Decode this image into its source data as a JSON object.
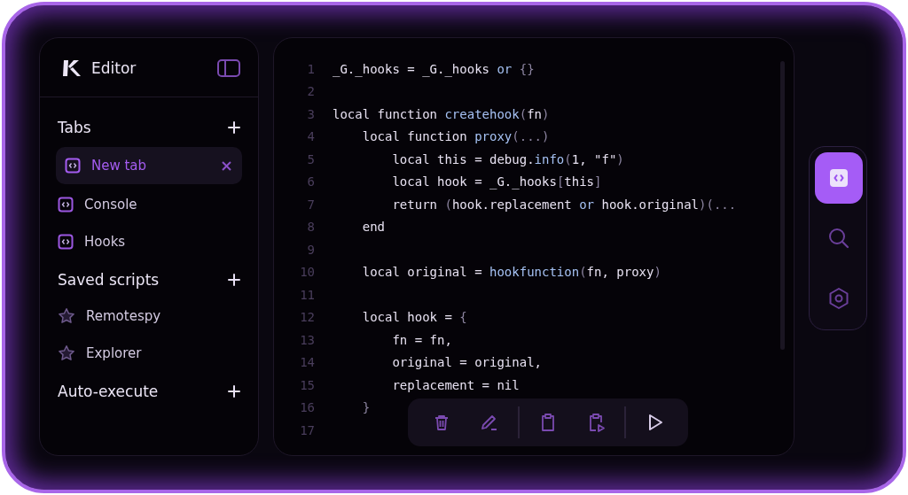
{
  "sidebar": {
    "title": "Editor",
    "sections": [
      {
        "title": "Tabs",
        "items": [
          {
            "label": "New tab",
            "kind": "tab",
            "selected": true
          },
          {
            "label": "Console",
            "kind": "tab",
            "selected": false
          },
          {
            "label": "Hooks",
            "kind": "tab",
            "selected": false
          }
        ]
      },
      {
        "title": "Saved scripts",
        "items": [
          {
            "label": "Remotespy",
            "kind": "script",
            "selected": false
          },
          {
            "label": "Explorer",
            "kind": "script",
            "selected": false
          }
        ]
      },
      {
        "title": "Auto-execute"
      }
    ]
  },
  "editor": {
    "lines": [
      {
        "number": "1",
        "tokens": [
          {
            "text": "_G._hooks = _G._hooks ",
            "kind": "plain"
          },
          {
            "text": "or",
            "kind": "accent"
          },
          {
            "text": " {}",
            "kind": "punct"
          }
        ]
      },
      {
        "number": "2"
      },
      {
        "number": "3",
        "tokens": [
          {
            "text": "local function ",
            "kind": "plain"
          },
          {
            "text": "createhook",
            "kind": "accent"
          },
          {
            "text": "(",
            "kind": "punct"
          },
          {
            "text": "fn",
            "kind": "plain"
          },
          {
            "text": ")",
            "kind": "punct"
          }
        ]
      },
      {
        "number": "4",
        "tokens": [
          {
            "text": "    local function ",
            "kind": "plain"
          },
          {
            "text": "proxy",
            "kind": "accent"
          },
          {
            "text": "(...)",
            "kind": "punct"
          }
        ]
      },
      {
        "number": "5",
        "tokens": [
          {
            "text": "        local this = debug.",
            "kind": "plain"
          },
          {
            "text": "info",
            "kind": "accent"
          },
          {
            "text": "(",
            "kind": "punct"
          },
          {
            "text": "1, \"f\"",
            "kind": "plain"
          },
          {
            "text": ")",
            "kind": "punct"
          }
        ]
      },
      {
        "number": "6",
        "tokens": [
          {
            "text": "        local hook = _G._hooks",
            "kind": "plain"
          },
          {
            "text": "[",
            "kind": "punct"
          },
          {
            "text": "this",
            "kind": "plain"
          },
          {
            "text": "]",
            "kind": "punct"
          }
        ]
      },
      {
        "number": "7",
        "tokens": [
          {
            "text": "        return ",
            "kind": "plain"
          },
          {
            "text": "(",
            "kind": "punct"
          },
          {
            "text": "hook.replacement ",
            "kind": "plain"
          },
          {
            "text": "or",
            "kind": "accent"
          },
          {
            "text": " hook.original",
            "kind": "plain"
          },
          {
            "text": ")(...",
            "kind": "punct"
          }
        ]
      },
      {
        "number": "8",
        "tokens": [
          {
            "text": "    end",
            "kind": "plain"
          }
        ]
      },
      {
        "number": "9"
      },
      {
        "number": "10",
        "tokens": [
          {
            "text": "    local original = ",
            "kind": "plain"
          },
          {
            "text": "hookfunction",
            "kind": "accent"
          },
          {
            "text": "(",
            "kind": "punct"
          },
          {
            "text": "fn, proxy",
            "kind": "plain"
          },
          {
            "text": ")",
            "kind": "punct"
          }
        ]
      },
      {
        "number": "11"
      },
      {
        "number": "12",
        "tokens": [
          {
            "text": "    local hook = ",
            "kind": "plain"
          },
          {
            "text": "{",
            "kind": "punct"
          }
        ]
      },
      {
        "number": "13",
        "tokens": [
          {
            "text": "        fn = fn,",
            "kind": "plain"
          }
        ]
      },
      {
        "number": "14",
        "tokens": [
          {
            "text": "        original = original,",
            "kind": "plain"
          }
        ]
      },
      {
        "number": "15",
        "tokens": [
          {
            "text": "        replacement = nil",
            "kind": "plain"
          }
        ]
      },
      {
        "number": "16",
        "tokens": [
          {
            "text": "    }",
            "kind": "punct"
          }
        ]
      },
      {
        "number": "17"
      }
    ],
    "toolbar": [
      {
        "kind": "trash"
      },
      {
        "kind": "pencil"
      },
      {
        "kind": "divider"
      },
      {
        "kind": "clipboard"
      },
      {
        "kind": "clipboard-run"
      },
      {
        "kind": "divider"
      },
      {
        "kind": "play"
      }
    ]
  },
  "rail": [
    {
      "kind": "code",
      "selected": true
    },
    {
      "kind": "search",
      "selected": false
    },
    {
      "kind": "settings",
      "selected": false
    }
  ]
}
